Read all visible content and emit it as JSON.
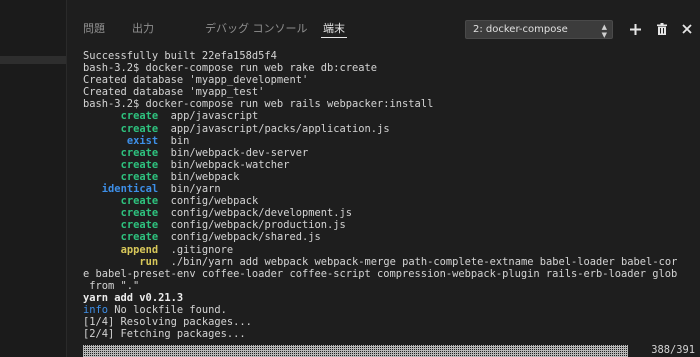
{
  "tabs": [
    {
      "label": "問題"
    },
    {
      "label": "出力"
    },
    {
      "label": "デバッグ コンソール"
    },
    {
      "label": "端末"
    }
  ],
  "terminal_select": {
    "value": "2: docker-compose"
  },
  "icons": {
    "add": "plus-icon",
    "delete": "trash-icon",
    "close": "close-icon",
    "dropdown": "chevron-updown-icon"
  },
  "colors": {
    "keyword_green": "#2ec27e",
    "keyword_blue": "#3d8fe8",
    "keyword_yellow": "#d8c85a",
    "text": "#d4d4d4",
    "background": "#1e1e1e"
  },
  "terminal": {
    "lines": [
      {
        "text": "Successfully built 22efa158d5f4"
      },
      {
        "text": "bash-3.2$ docker-compose run web rake db:create"
      },
      {
        "text": "Created database 'myapp_development'"
      },
      {
        "text": "Created database 'myapp_test'"
      },
      {
        "text": "bash-3.2$ docker-compose run web rails webpacker:install"
      },
      {
        "kw": "create",
        "rest": "app/javascript"
      },
      {
        "kw": "create",
        "rest": "app/javascript/packs/application.js"
      },
      {
        "kw": "exist",
        "rest": "bin"
      },
      {
        "kw": "create",
        "rest": "bin/webpack-dev-server"
      },
      {
        "kw": "create",
        "rest": "bin/webpack-watcher"
      },
      {
        "kw": "create",
        "rest": "bin/webpack"
      },
      {
        "kw": "identical",
        "rest": "bin/yarn"
      },
      {
        "kw": "create",
        "rest": "config/webpack"
      },
      {
        "kw": "create",
        "rest": "config/webpack/development.js"
      },
      {
        "kw": "create",
        "rest": "config/webpack/production.js"
      },
      {
        "kw": "create",
        "rest": "config/webpack/shared.js"
      },
      {
        "kw": "append",
        "rest": ".gitignore"
      },
      {
        "kw": "run",
        "rest": "./bin/yarn add webpack webpack-merge path-complete-extname babel-loader babel-cor"
      },
      {
        "text": "e babel-preset-env coffee-loader coffee-script compression-webpack-plugin rails-erb-loader glob"
      },
      {
        "text": " from \".\""
      },
      {
        "text": "yarn add v0.21.3"
      },
      {
        "info": "info",
        "rest": "No lockfile found."
      },
      {
        "text": "[1/4] Resolving packages..."
      },
      {
        "text": "[2/4] Fetching packages..."
      }
    ],
    "progress_fraction": 0.89,
    "progress_count": "388/391"
  }
}
